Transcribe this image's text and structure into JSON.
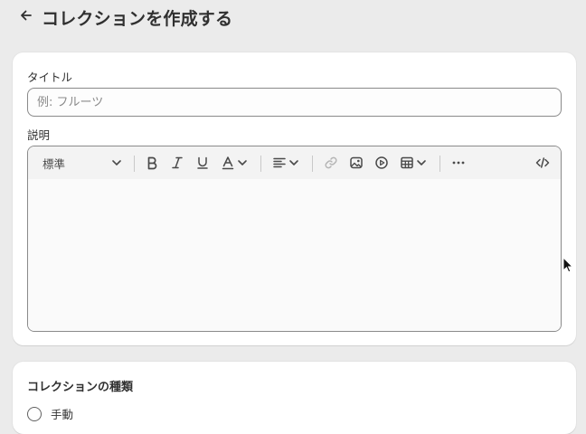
{
  "header": {
    "title": "コレクションを作成する"
  },
  "main_card": {
    "title_label": "タイトル",
    "title_value": "",
    "title_placeholder": "例: フルーツ",
    "description_label": "説明",
    "editor": {
      "format_select_value": "標準",
      "description_value": ""
    }
  },
  "type_card": {
    "title": "コレクションの種類",
    "options": [
      {
        "label": "手動",
        "selected": false
      }
    ]
  },
  "icons": [
    "arrow-left-icon",
    "chevron-down-icon",
    "bold-icon",
    "italic-icon",
    "underline-icon",
    "text-color-icon",
    "align-left-icon",
    "link-icon",
    "image-icon",
    "video-icon",
    "table-icon",
    "more-horizontal-icon",
    "code-icon",
    "mouse-cursor-icon"
  ],
  "colors": {
    "page_background": "#ebebeb",
    "card_background": "#ffffff",
    "border": "#8a8a8a",
    "text": "#303030",
    "toolbar_background": "#f3f3f3"
  }
}
